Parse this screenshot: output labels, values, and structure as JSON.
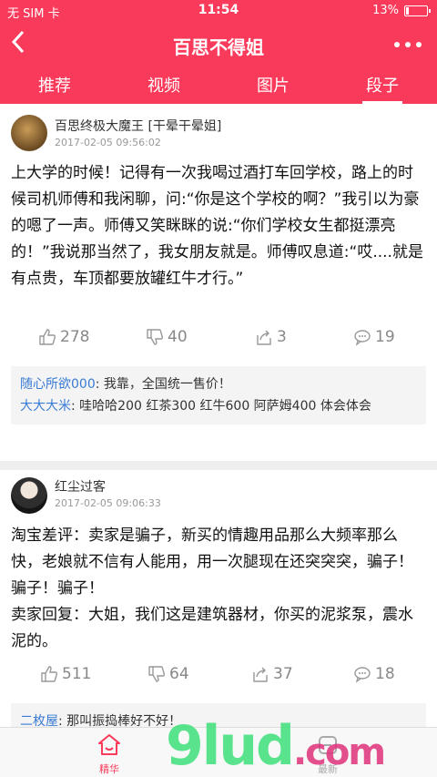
{
  "status_bar": {
    "carrier": "无 SIM 卡",
    "time": "11:54",
    "battery": "13%",
    "battery_level": 0.13
  },
  "nav": {
    "title": "百思不得姐"
  },
  "tabs": [
    {
      "label": "推荐"
    },
    {
      "label": "视频"
    },
    {
      "label": "图片"
    },
    {
      "label": "段子",
      "active": true
    }
  ],
  "posts": [
    {
      "username": "百思终极大魔王 [干晕干晕姐]",
      "timestamp": "2017-02-05 09:56:02",
      "content": "上大学的时候！记得有一次我喝过酒打车回学校，路上的时候司机师傅和我闲聊，问:“你是这个学校的啊？”我引以为豪的嗯了一声。师傅又笑眯眯的说:“你们学校女生都挺漂亮的！”我说那当然了，我女朋友就是。师傅叹息道:“哎....就是有点贵，车顶都要放罐红牛才行。”",
      "likes": "278",
      "dislikes": "40",
      "shares": "3",
      "comments_count": "19",
      "comments": [
        {
          "user": "随心所欲000",
          "text": ": 我靠，全国统一售价！"
        },
        {
          "user": "大大大米",
          "text": ": 哇哈哈200 红茶300 红牛600 阿萨姆400 体会体会"
        }
      ]
    },
    {
      "username": "红尘过客",
      "timestamp": "2017-02-05 09:06:33",
      "content": "淘宝差评：卖家是骗子，新买的情趣用品那么大频率那么快，老娘就不信有人能用，用一次腿现在还突突突，骗子！骗子！骗子！\n卖家回复：大姐，我们这是建筑器材，你买的泥浆泵，震水泥的。",
      "likes": "511",
      "dislikes": "64",
      "shares": "37",
      "comments_count": "18",
      "comments": [
        {
          "user": "二枚屋",
          "text": ": 那叫振捣棒好不好！"
        }
      ]
    }
  ],
  "tabbar": [
    {
      "label": "精华",
      "icon": "home-icon"
    },
    {
      "label": "最新",
      "icon": "new-icon"
    }
  ],
  "watermark": {
    "main": "9lud",
    "suffix": ".com"
  },
  "colors": {
    "brand": "#fa3a5a",
    "comment_user": "#3a7bd5"
  }
}
